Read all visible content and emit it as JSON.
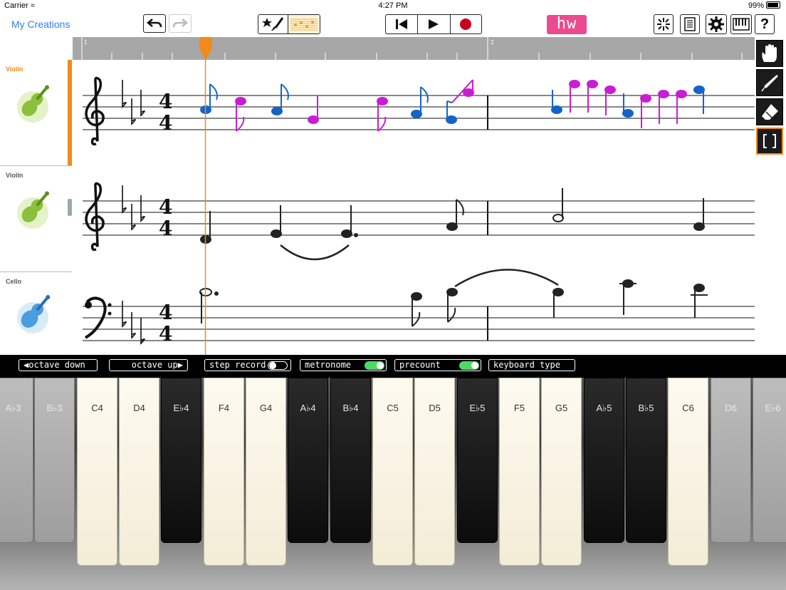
{
  "status": {
    "carrier": "Carrier",
    "time": "4:27 PM",
    "battery": "99%"
  },
  "toolbar": {
    "my_creations": "My Creations",
    "hw_label": "hw"
  },
  "timeline": {
    "measures": [
      "1",
      "2"
    ]
  },
  "tracks": [
    {
      "name": "Violin",
      "selected": true
    },
    {
      "name": "Violin",
      "selected": false
    },
    {
      "name": "Cello",
      "selected": false
    }
  ],
  "controls": {
    "octave_down": "octave down",
    "octave_up": "octave up",
    "step_record": "step record",
    "metronome": "metronome",
    "precount": "precount",
    "keyboard_type": "keyboard type",
    "step_record_on": false,
    "metronome_on": true,
    "precount_on": true
  },
  "keyboard": {
    "keys": [
      {
        "label": "A♭3",
        "color": "grey"
      },
      {
        "label": "B♭3",
        "color": "grey"
      },
      {
        "label": "C4",
        "color": "white"
      },
      {
        "label": "D4",
        "color": "white"
      },
      {
        "label": "E♭4",
        "color": "black"
      },
      {
        "label": "F4",
        "color": "white"
      },
      {
        "label": "G4",
        "color": "white"
      },
      {
        "label": "A♭4",
        "color": "black"
      },
      {
        "label": "B♭4",
        "color": "black"
      },
      {
        "label": "C5",
        "color": "white"
      },
      {
        "label": "D5",
        "color": "white"
      },
      {
        "label": "E♭5",
        "color": "black"
      },
      {
        "label": "F5",
        "color": "white"
      },
      {
        "label": "G5",
        "color": "white"
      },
      {
        "label": "A♭5",
        "color": "black"
      },
      {
        "label": "B♭5",
        "color": "black"
      },
      {
        "label": "C6",
        "color": "white"
      },
      {
        "label": "D6",
        "color": "grey"
      },
      {
        "label": "E♭6",
        "color": "grey"
      }
    ]
  },
  "score": {
    "time_signature": {
      "top": "4",
      "bottom": "4"
    },
    "colors": {
      "note_blue": "#1464c8",
      "note_magenta": "#c81ed2",
      "playhead": "#f08a1a"
    }
  }
}
